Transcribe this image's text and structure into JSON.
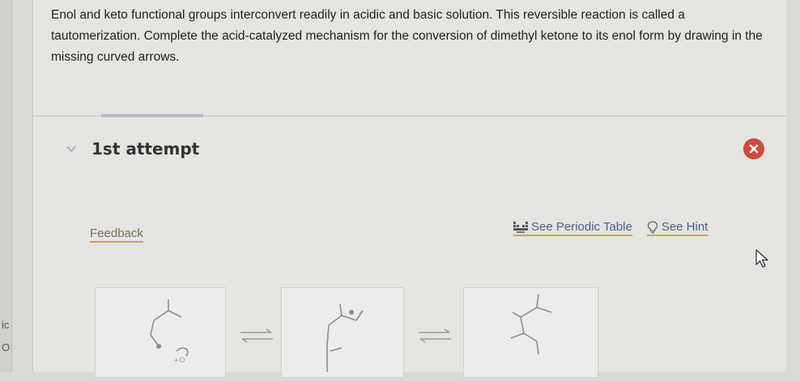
{
  "question": {
    "text": "Enol and keto functional groups interconvert readily in acidic and basic solution. This reversible reaction is called a tautomerization. Complete the acid-catalyzed mechanism for the conversion of dimethyl ketone to its enol form by drawing in the missing curved arrows."
  },
  "attempt": {
    "label": "1st attempt",
    "status": "incorrect",
    "status_color": "#d2483c"
  },
  "links": {
    "feedback": "Feedback",
    "periodic_table": "See Periodic Table",
    "hint": "See Hint"
  },
  "left_edge": {
    "fragment_1": "ic",
    "fragment_2": "O"
  },
  "colors": {
    "link_underline": "#c9a35e",
    "accent_blue": "#a9b9cf"
  }
}
